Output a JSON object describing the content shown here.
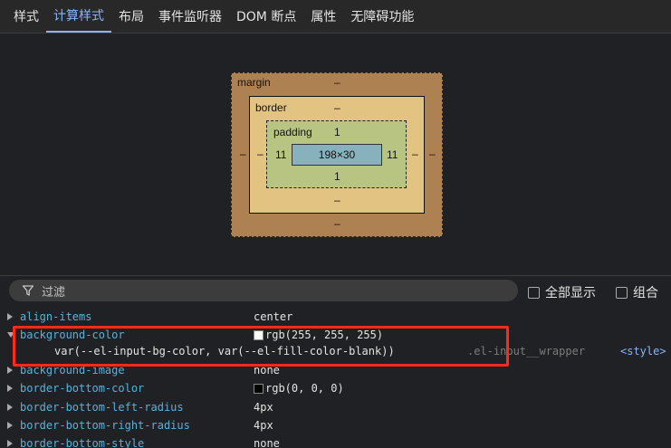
{
  "tabs": [
    {
      "label": "样式",
      "active": false
    },
    {
      "label": "计算样式",
      "active": true
    },
    {
      "label": "布局",
      "active": false
    },
    {
      "label": "事件监听器",
      "active": false
    },
    {
      "label": "DOM 断点",
      "active": false
    },
    {
      "label": "属性",
      "active": false
    },
    {
      "label": "无障碍功能",
      "active": false
    }
  ],
  "box_model": {
    "margin_label": "margin",
    "margin_top": "–",
    "margin_bottom": "–",
    "margin_left": "–",
    "margin_right": "–",
    "border_label": "border",
    "border_top": "–",
    "border_bottom": "–",
    "border_left": "–",
    "border_right": "–",
    "padding_label": "padding",
    "padding_top": "1",
    "padding_bottom": "1",
    "padding_left": "11",
    "padding_right": "11",
    "content_size": "198×30",
    "colors": {
      "margin": "#ae8152",
      "border": "#e3c381",
      "padding": "#b8c481",
      "content": "#88b1be"
    }
  },
  "filter": {
    "placeholder": "过滤",
    "show_all_label": "全部显示",
    "group_label": "组合"
  },
  "properties": [
    {
      "name": "align-items",
      "value": "center",
      "expanded": false
    },
    {
      "name": "background-color",
      "value": "rgb(255, 255, 255)",
      "swatch": "#ffffff",
      "expanded": true,
      "trace": {
        "value": "var(--el-input-bg-color, var(--el-fill-color-blank))",
        "selector": ".el-input__wrapper",
        "source": "<style>"
      }
    },
    {
      "name": "background-image",
      "value": "none",
      "expanded": false
    },
    {
      "name": "border-bottom-color",
      "value": "rgb(0, 0, 0)",
      "swatch": "#000000",
      "expanded": false
    },
    {
      "name": "border-bottom-left-radius",
      "value": "4px",
      "expanded": false
    },
    {
      "name": "border-bottom-right-radius",
      "value": "4px",
      "expanded": false
    },
    {
      "name": "border-bottom-style",
      "value": "none",
      "expanded": false
    }
  ],
  "colors": {
    "accent": "#8ab4f8",
    "property_name": "#5db0d7",
    "highlight": "#ff2a1a"
  }
}
